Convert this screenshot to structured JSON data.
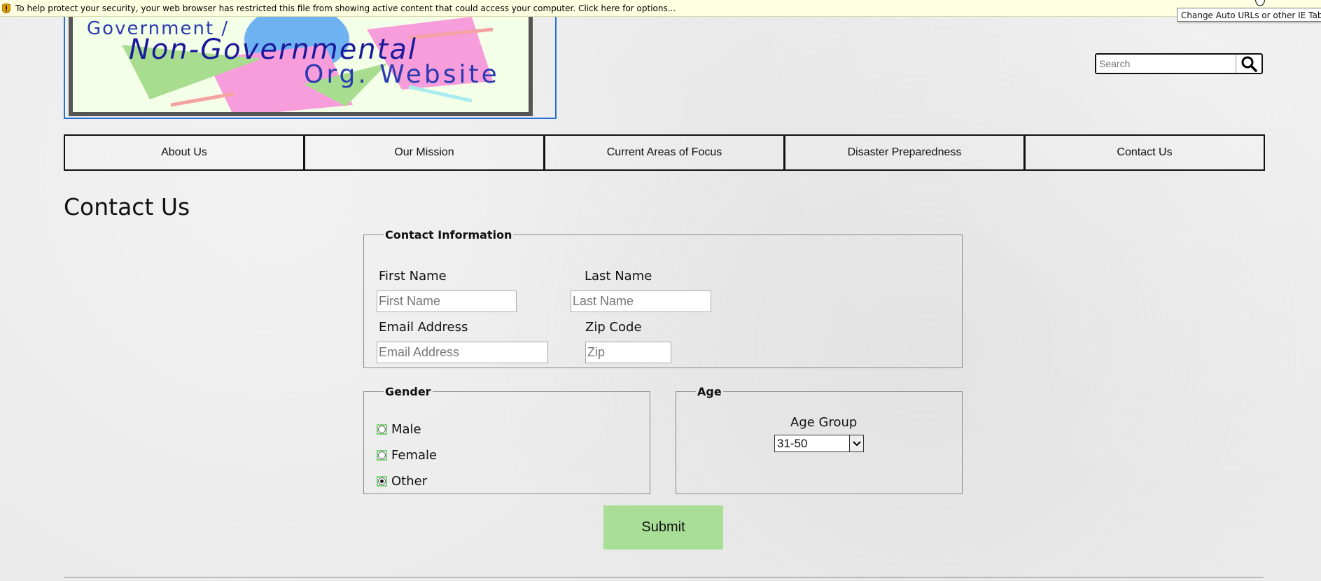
{
  "infobar": {
    "message": "To help protect your security, your web browser has restricted this file from showing active content that could access your computer. Click here for options..."
  },
  "tooltip": {
    "text": "Change Auto URLs or other IE Tab settings"
  },
  "logo": {
    "line1": "Government /",
    "line2": "Non-Governmental",
    "line3": "Org. Website"
  },
  "search": {
    "placeholder": "Search"
  },
  "nav": {
    "items": [
      {
        "label": "About Us"
      },
      {
        "label": "Our Mission"
      },
      {
        "label": "Current Areas of Focus"
      },
      {
        "label": "Disaster Preparedness"
      },
      {
        "label": "Contact Us"
      }
    ]
  },
  "page": {
    "title": "Contact Us"
  },
  "contact": {
    "legend": "Contact Information",
    "first_name_label": "First Name",
    "first_name_placeholder": "First Name",
    "last_name_label": "Last Name",
    "last_name_placeholder": "Last Name",
    "email_label": "Email Address",
    "email_placeholder": "Email Address",
    "zip_label": "Zip Code",
    "zip_placeholder": "Zip"
  },
  "gender": {
    "legend": "Gender",
    "options": [
      {
        "label": "Male",
        "checked": false
      },
      {
        "label": "Female",
        "checked": false
      },
      {
        "label": "Other",
        "checked": true
      }
    ]
  },
  "age": {
    "legend": "Age",
    "group_label": "Age Group",
    "selected": "31-50"
  },
  "submit": {
    "label": "Submit"
  },
  "colors": {
    "infobar_bg": "#ffffe1",
    "submit_bg": "#a8de96",
    "radio_border": "#7ccf7c",
    "logo_frame": "#2a6fd6"
  }
}
